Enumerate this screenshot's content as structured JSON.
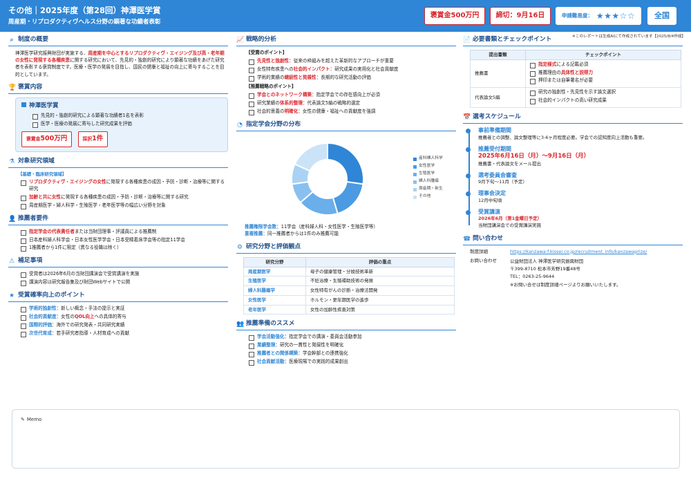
{
  "header": {
    "title": "その他｜2025年度（第28回）神澤医学賞",
    "subtitle": "周産期・リプロダクティヴヘルス分野の顕著な功績者表彰",
    "prize_badge": "褒賞金500万円",
    "deadline_badge": "締切：9月16日",
    "difficulty_label": "申請難易度：",
    "difficulty_stars": "★★★☆☆",
    "scope_badge": "全国",
    "note": "＊このレポートは生成AIにて作成されています【2025/8/4作成】"
  },
  "overview": {
    "title": "制度の概要",
    "text_a": "神澤医学研究振興財団が実施する、",
    "text_red": "周産期を中心とするリプロダクティヴ・エイジング及び高・老年期の女性に発現する各種疾患",
    "text_b": "に関する研究において、先見的・独創的研究により顕著な功績をあげた研究者を表彰する褒賞制度です。医療・医学の発展を目指し、国民の健康と福祉の向上に寄与することを目的としています。"
  },
  "award": {
    "title": "褒賞内容",
    "prize_name": "神澤医学賞",
    "items": [
      "先見的・独創的研究による顕著な功績者1名を表彰",
      "医学・医療の発展に寄与した研究成果を評価"
    ],
    "badge_money_small": "褒賞金",
    "badge_money": "500万円",
    "badge_count_small": "採択",
    "badge_count": "1件"
  },
  "research_area": {
    "title": "対象研究領域",
    "category": "【基礎・臨床研究領域】",
    "item1_red": "リプロダクティヴ・エイジングの女性",
    "item1_rest": "に発現する各種疾患の成因・予防・診断・治療等に関する研究",
    "item2_red": "加齢と共に女性",
    "item2_rest": "に発現する各種疾患の成因・予防・診断・治療等に関する研究",
    "item3": "周産期医学・婦人科学・生殖医学・老年医学等の幅広い分野を対象"
  },
  "nomination": {
    "title": "推薦者要件",
    "item1_red": "指定学会の代表責任者",
    "item1_rest": "または当財団理事・評議員による推薦制",
    "item2": "日本産科婦人科学会・日本女性医学学会・日本受精着床学会等の指定11学会",
    "item3": "1推薦者から1件に限定（異なる役職は除く）"
  },
  "supplement": {
    "title": "補足事項",
    "items": [
      "受賞者は2026年6月の当財団講演会で受賞講演を実施",
      "講演内容は研究報告集及び財団Webサイトで公開"
    ]
  },
  "tips": {
    "title": "受賞確率向上のポイント",
    "item1_blue": "学術的独創性",
    "item1_rest": "：新しい概念・手法の提示と実証",
    "item2_blue": "社会的貢献度",
    "item2_mid": "：女性の",
    "item2_red": "QOL向上",
    "item2_rest": "への具体的寄与",
    "item3_blue": "国際的評価",
    "item3_rest": "：海外での研究発表・共同研究実績",
    "item4_blue": "次世代育成",
    "item4_rest": "：若手研究者指導・人材育成への貢献"
  },
  "strategy": {
    "title": "戦略的分析",
    "award_points_head": "【受賞のポイント】",
    "a1_red": "先見性と独創性",
    "a1_rest": "：従来の枠組みを超えた革新的なアプローチが重要",
    "a2_pre": "女性特有疾患への",
    "a2_red": "社会的インパクト",
    "a2_rest": "：研究成果の実用化と社会貢献度",
    "a3_pre": "学術的業績の",
    "a3_red": "継続性と発展性",
    "a3_rest": "：長期的な研究活動の評価",
    "nom_points_head": "【推薦戦略のポイント】",
    "b1_red": "学会とのネットワーク構築",
    "b1_rest": "：指定学会での存在感向上が必須",
    "b2_pre": "研究業績の",
    "b2_red": "体系的整理",
    "b2_rest": "：代表論文5編の戦略的選定",
    "b3_pre": "社会的意義の",
    "b3_red": "明確化",
    "b3_rest": "：女性の健康・福祉への貢献度を強調"
  },
  "society_chart": {
    "title": "指定学会分野の分布",
    "note1_label": "推薦権限学会数",
    "note1_text": "：11学会（産科婦人科・女性医学・生殖医学等）",
    "note2_label": "重複推薦",
    "note2_text": "：同一推薦者からは1件のみ推薦可能"
  },
  "chart_data": {
    "type": "pie",
    "categories": [
      "産科婦人科学",
      "女性医学",
      "生殖医学",
      "婦人科腫瘍",
      "周産期・新生",
      "その他"
    ],
    "values": [
      3,
      2,
      2,
      1,
      1,
      2
    ],
    "colors": [
      "#2f86d6",
      "#4c9be2",
      "#6aaeea",
      "#89c0ef",
      "#a9d2f4",
      "#cbe3f8"
    ],
    "legend_position": "right"
  },
  "evaluation": {
    "title": "研究分野と評価観点",
    "headers": [
      "研究分野",
      "評価の重点"
    ],
    "rows": [
      [
        "周産期医学",
        "母子の健康管理・分娩技術革新"
      ],
      [
        "生殖医学",
        "不妊治療・生殖補助技術の発展"
      ],
      [
        "婦人科腫瘍学",
        "女性特有がんの診断・治療法開発"
      ],
      [
        "女性医学",
        "ホルモン・更年期医学の進歩"
      ],
      [
        "老年医学",
        "女性の加齢性疾患対策"
      ]
    ]
  },
  "prep": {
    "title": "推薦準備のススメ",
    "item1_blue": "学会活動強化",
    "item1_rest": "：指定学会での講演・委員会活動参加",
    "item2_blue": "業績整理",
    "item2_rest": "：研究の一貫性と発展性を明確化",
    "item3_blue": "推薦者との関係構築",
    "item3_rest": "：学会幹部との連携強化",
    "item4_blue": "社会貢献活動",
    "item4_rest": "：医療現場での実践的成果創出"
  },
  "documents": {
    "title": "必要書類とチェックポイント",
    "headers": [
      "提出書類",
      "チェックポイント"
    ],
    "doc1": "推薦書",
    "doc1_c1_red": "指定様式",
    "doc1_c1_rest": "による記載必須",
    "doc1_c2_pre": "推薦理由の",
    "doc1_c2_red": "具体性と説得力",
    "doc1_c3": "押印または自筆署名が必要",
    "doc2": "代表論文5編",
    "doc2_c1": "研究の独創性・先見性を示す論文選択",
    "doc2_c2": "社会的インパクトの高い研究成果"
  },
  "schedule": {
    "title": "選考スケジュール",
    "s1_title": "事前準備期間",
    "s1_text": "推薦者との調整、論文整理等に3-6ヶ月程度必要。学会での認知度向上活動も重要。",
    "s2_title": "推薦受付期間",
    "s2_big": "2025年6月16日（月）〜9月16日（月）",
    "s2_text": "推薦書・代表論文をメール提出",
    "s3_title": "選考委員会審査",
    "s3_text": "9月下旬〜11月（予定）",
    "s4_title": "理事会決定",
    "s4_text": "12月中旬頃",
    "s5_title": "受賞講演",
    "s5_red": "2026年6月（第1金曜日予定）",
    "s5_text": "当財団講演会での受賞講演実施"
  },
  "contact": {
    "title": "問い合わせ",
    "detail_label": "制度詳細",
    "detail_link": "https://kanzawa-f.kissei.co.jp/recruitment_info/kanzawaprize/",
    "inquiry_label": "お問い合わせ",
    "org": "公益財団法人 神澤医学研究振興財団",
    "address": "〒399-8710 松本市芳野19番48号",
    "tel": "TEL：0263-25-9644",
    "note": "※お問い合せは制度詳細ページよりお願いいたします。"
  },
  "memo": {
    "label": "Memo"
  }
}
